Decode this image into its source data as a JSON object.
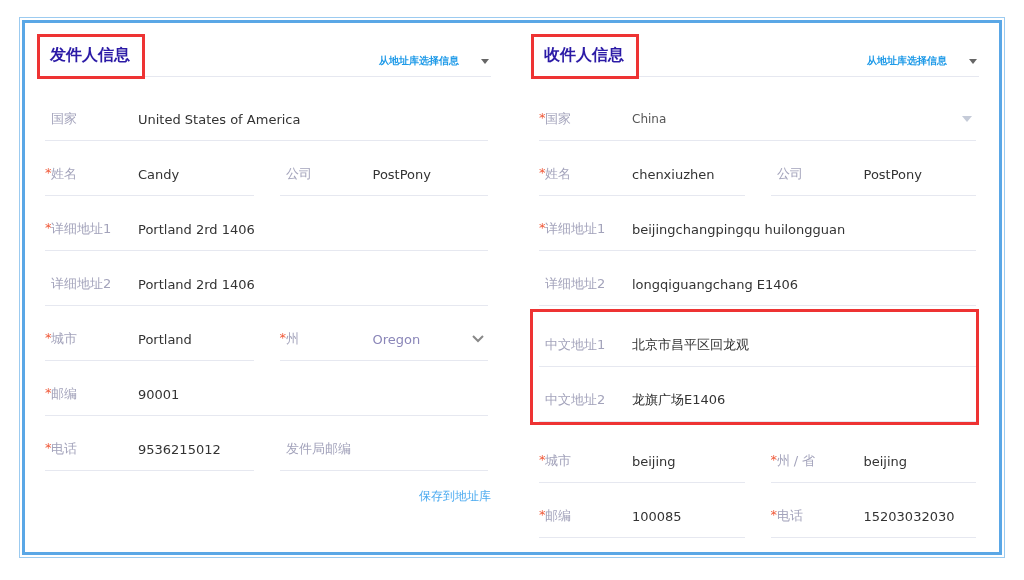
{
  "panels": [
    {
      "title": "发件人信息",
      "title_highlighted": true,
      "library_link": "从地址库选择信息",
      "sections": [
        {
          "highlighted": false,
          "rows": [
            {
              "fields": [
                {
                  "label": "国家",
                  "value": "United States of America",
                  "kind": "text"
                }
              ]
            },
            {
              "fields": [
                {
                  "mark": "*",
                  "label": "姓名",
                  "value": "Candy",
                  "kind": "text"
                },
                {
                  "label": "公司",
                  "value": "PostPony",
                  "kind": "text"
                }
              ]
            },
            {
              "fields": [
                {
                  "mark": "*",
                  "label": "详细地址1",
                  "value": "Portland 2rd 1406",
                  "kind": "text"
                }
              ]
            },
            {
              "fields": [
                {
                  "label": "详细地址2",
                  "value": "Portland 2rd 1406",
                  "kind": "text"
                }
              ]
            },
            {
              "fields": [
                {
                  "mark": "*",
                  "label": "城市",
                  "value": "Portland",
                  "kind": "text"
                },
                {
                  "mark": "*",
                  "label": "州",
                  "value": "Oregon",
                  "kind": "chevron"
                }
              ]
            },
            {
              "fields": [
                {
                  "mark": "*",
                  "label": "邮编",
                  "value": "90001",
                  "kind": "text"
                }
              ]
            },
            {
              "fields": [
                {
                  "mark": "*",
                  "label": "电话",
                  "value": "9536215012",
                  "kind": "text"
                },
                {
                  "placeholder": "发件局邮编",
                  "kind": "text"
                }
              ]
            }
          ]
        }
      ],
      "save_link": "保存到地址库"
    },
    {
      "title": "收件人信息",
      "title_highlighted": true,
      "library_link": "从地址库选择信息",
      "sections": [
        {
          "highlighted": false,
          "rows": [
            {
              "fields": [
                {
                  "mark": "*",
                  "label": "国家",
                  "value": "China",
                  "kind": "select"
                }
              ]
            },
            {
              "fields": [
                {
                  "mark": "*",
                  "label": "姓名",
                  "value": "chenxiuzhen",
                  "kind": "text"
                },
                {
                  "label": "公司",
                  "value": "PostPony",
                  "kind": "text"
                }
              ]
            },
            {
              "fields": [
                {
                  "mark": "*",
                  "label": "详细地址1",
                  "value": "beijingchangpingqu huilongguan",
                  "kind": "text"
                }
              ]
            },
            {
              "fields": [
                {
                  "label": "详细地址2",
                  "value": "longqiguangchang E1406",
                  "kind": "text"
                }
              ]
            }
          ]
        },
        {
          "highlighted": true,
          "rows": [
            {
              "fields": [
                {
                  "label": "中文地址1",
                  "value": "北京市昌平区回龙观",
                  "kind": "text"
                }
              ]
            },
            {
              "fields": [
                {
                  "label": "中文地址2",
                  "value": "龙旗广场E1406",
                  "kind": "text"
                }
              ]
            }
          ]
        },
        {
          "highlighted": false,
          "rows": [
            {
              "fields": [
                {
                  "mark": "*",
                  "label": "城市",
                  "value": "beijing",
                  "kind": "text"
                },
                {
                  "mark": "*",
                  "label": "州 / 省",
                  "value": "beijing",
                  "kind": "text"
                }
              ]
            },
            {
              "fields": [
                {
                  "mark": "*",
                  "label": "邮编",
                  "value": "100085",
                  "kind": "text"
                },
                {
                  "mark": "*",
                  "label": "电话",
                  "value": "15203032030",
                  "kind": "text"
                }
              ]
            }
          ]
        }
      ]
    }
  ]
}
